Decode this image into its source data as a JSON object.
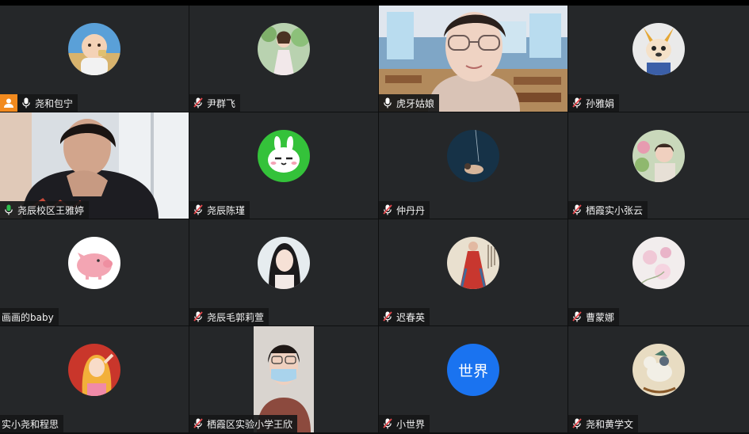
{
  "colors": {
    "tile_bg": "#252729",
    "active_border": "#2fbf4f",
    "muted_mic": "#e5484d",
    "host_badge": "#f28a1e",
    "text_avatar": "#1a73f0"
  },
  "participants": [
    {
      "name": "尧和包宁",
      "mic": "mic-on-icon",
      "host": true,
      "media": "avatar",
      "avatar_icon": "baby-photo-avatar"
    },
    {
      "name": "尹群飞",
      "mic": "mic-muted-icon",
      "media": "avatar",
      "avatar_icon": "woman-in-dress-avatar"
    },
    {
      "name": "虎牙姑娘",
      "mic": "mic-on-icon",
      "media": "video",
      "video_desc": "classroom-background-video"
    },
    {
      "name": "孙雅娟",
      "mic": "mic-muted-icon",
      "media": "avatar",
      "avatar_icon": "cartoon-dog-avatar"
    },
    {
      "name": "尧辰校区王雅婷",
      "mic": "mic-active-icon",
      "active": true,
      "media": "video",
      "video_desc": "woman-at-window-video"
    },
    {
      "name": "尧辰陈瑾",
      "mic": "mic-muted-icon",
      "media": "avatar",
      "avatar_icon": "green-rabbit-avatar"
    },
    {
      "name": "仲丹丹",
      "mic": "mic-muted-icon",
      "media": "avatar",
      "avatar_icon": "dark-blue-photo-avatar"
    },
    {
      "name": "栖霞实小张云",
      "mic": "mic-muted-icon",
      "media": "avatar",
      "avatar_icon": "flower-photo-avatar"
    },
    {
      "name": "画画的baby",
      "mic": null,
      "media": "avatar",
      "avatar_icon": "pink-pig-avatar"
    },
    {
      "name": "尧辰毛郭莉萱",
      "mic": "mic-muted-icon",
      "media": "avatar",
      "avatar_icon": "woman-portrait-avatar"
    },
    {
      "name": "迟春英",
      "mic": "mic-muted-icon",
      "media": "avatar",
      "avatar_icon": "red-dress-painting-avatar"
    },
    {
      "name": "曹蒙娜",
      "mic": "mic-muted-icon",
      "media": "avatar",
      "avatar_icon": "pink-flowers-avatar"
    },
    {
      "name": "实小尧和程思",
      "mic": null,
      "media": "avatar",
      "avatar_icon": "cartoon-girl-avatar"
    },
    {
      "name": "栖霞区实验小学王欣",
      "mic": "mic-muted-icon",
      "media": "video",
      "video_desc": "woman-with-mask-video"
    },
    {
      "name": "小世界",
      "mic": "mic-muted-icon",
      "media": "text-avatar",
      "avatar_text": "世界"
    },
    {
      "name": "尧和黄学文",
      "mic": "mic-muted-icon",
      "media": "avatar",
      "avatar_icon": "rocking-horse-avatar"
    }
  ]
}
